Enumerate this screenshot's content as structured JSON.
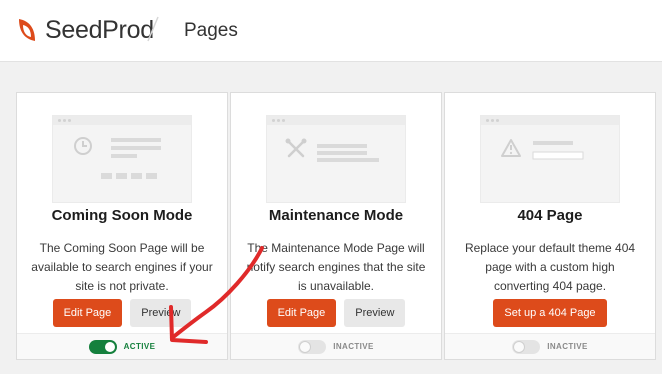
{
  "header": {
    "brand": "SeedProd",
    "page_title": "Pages"
  },
  "colors": {
    "brand_accent": "#dd4b1b",
    "active_green": "#15803d",
    "arrow_red": "#e02a2a"
  },
  "cards": [
    {
      "title": "Coming Soon Mode",
      "description": "The Coming Soon Page will be available to search engines if your site is not private.",
      "thumbnail_icon": "clock-icon",
      "primary_button": "Edit Page",
      "secondary_button": "Preview",
      "status": "ACTIVE",
      "toggle_on": true
    },
    {
      "title": "Maintenance Mode",
      "description": "The Maintenance Mode Page will notify search engines that the site is unavailable.",
      "thumbnail_icon": "tools-icon",
      "primary_button": "Edit Page",
      "secondary_button": "Preview",
      "status": "INACTIVE",
      "toggle_on": false
    },
    {
      "title": "404 Page",
      "description": "Replace your default theme 404 page with a custom high converting 404 page.",
      "thumbnail_icon": "warning-icon",
      "primary_button": "Set up a 404 Page",
      "status": "INACTIVE",
      "toggle_on": false
    }
  ]
}
